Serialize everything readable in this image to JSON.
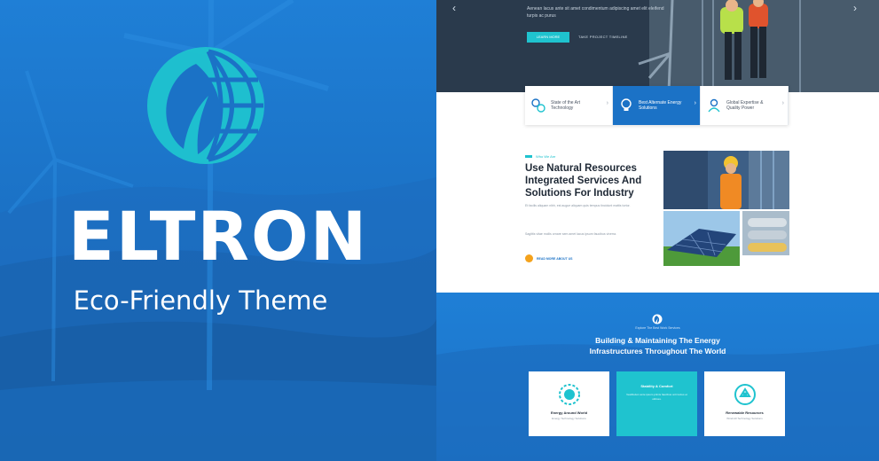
{
  "hero_left": {
    "brand": "ELTRON",
    "tagline": "Eco-Friendly Theme",
    "logo_icon": "leaf-globe-logo"
  },
  "preview": {
    "slider": {
      "intro_text": "Aenean lacus ante sit amet condimentum adipiscing amet elit eleifend turpis ac purus",
      "cta_label": "LEARN MORE",
      "secondary_link": "TAKE PROJECT TIMELINE"
    },
    "features": [
      {
        "label": "State of the Art Technology",
        "icon": "gears-icon"
      },
      {
        "label": "Best Alternate Energy Solutions",
        "icon": "bulb-icon"
      },
      {
        "label": "Global Expertise & Quality Power",
        "icon": "worker-icon"
      }
    ],
    "about": {
      "eyebrow": "Who We Are",
      "headline": "Use Natural Resources Integrated Services And Solutions For Industry",
      "paragraph_1": "Et facilis aliquam nibh, est augue aliquam quis tempus tincidunt mattis tortor.",
      "paragraph_2": "Sagittis vitae mollis ornare sem amet lacus ipsum faucibus viverra.",
      "read_more": "READ MORE ABOUT US"
    },
    "services": {
      "eyebrow": "Explore The Best Work Services",
      "title_line1": "Building & Maintaining The Energy",
      "title_line2": "Infrastructures Throughout The World",
      "cards": [
        {
          "title": "Energy Around World",
          "subtitle": "Energy Technology Solutions",
          "icon": "globe-gear-icon"
        },
        {
          "title": "Stability & Comfort",
          "subtitle": "Vestibulum ante ipsum primis faucibus orci luctus et ultrices.",
          "icon": ""
        },
        {
          "title": "Renewable Resources",
          "subtitle": "Windmill Technology Solutions",
          "icon": "recycle-icon"
        }
      ]
    }
  },
  "colors": {
    "brand_blue": "#1b72c6",
    "accent_cyan": "#1fc3cf",
    "accent_orange": "#f4a21c"
  }
}
